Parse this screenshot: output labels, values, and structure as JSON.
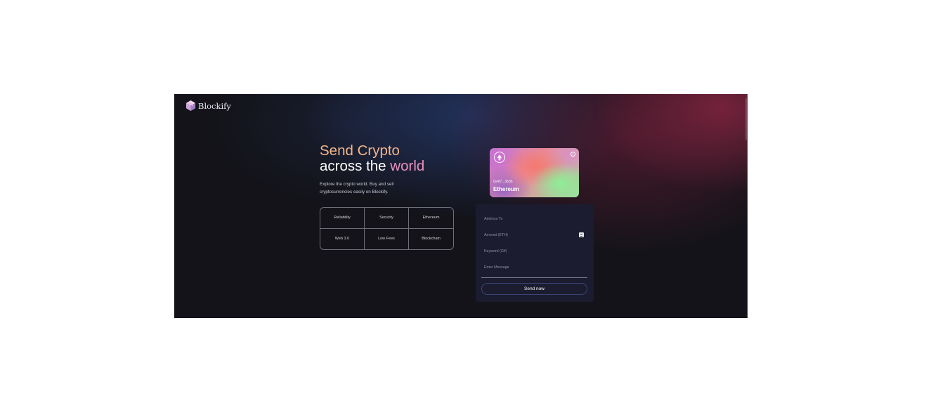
{
  "brand": {
    "name": "Blockify",
    "icon": "cube-logo-icon"
  },
  "hero": {
    "title_part1": "Send Crypto",
    "title_part2": "across the ",
    "title_part3": "world",
    "subtitle": "Explore the crypto world. Buy and sell cryptocurrencies easily on Blockify."
  },
  "features": [
    "Reliability",
    "Security",
    "Ethereum",
    "Web 3.0",
    "Low Fees",
    "Blockchain"
  ],
  "card": {
    "address": "0x4f7...3636",
    "network": "Ethereum",
    "logo_icon": "ethereum-icon",
    "info_icon": "info-icon"
  },
  "form": {
    "address_placeholder": "Address To",
    "amount_placeholder": "Amount (ETH)",
    "keyword_placeholder": "Keyword (Gif)",
    "message_placeholder": "Enter Message",
    "submit_label": "Send now"
  },
  "colors": {
    "background": "#131319",
    "accent_orange": "#f2b58a",
    "accent_pink": "#e98fbf",
    "form_background": "#1b1c2f",
    "button_border": "#3a4577"
  }
}
